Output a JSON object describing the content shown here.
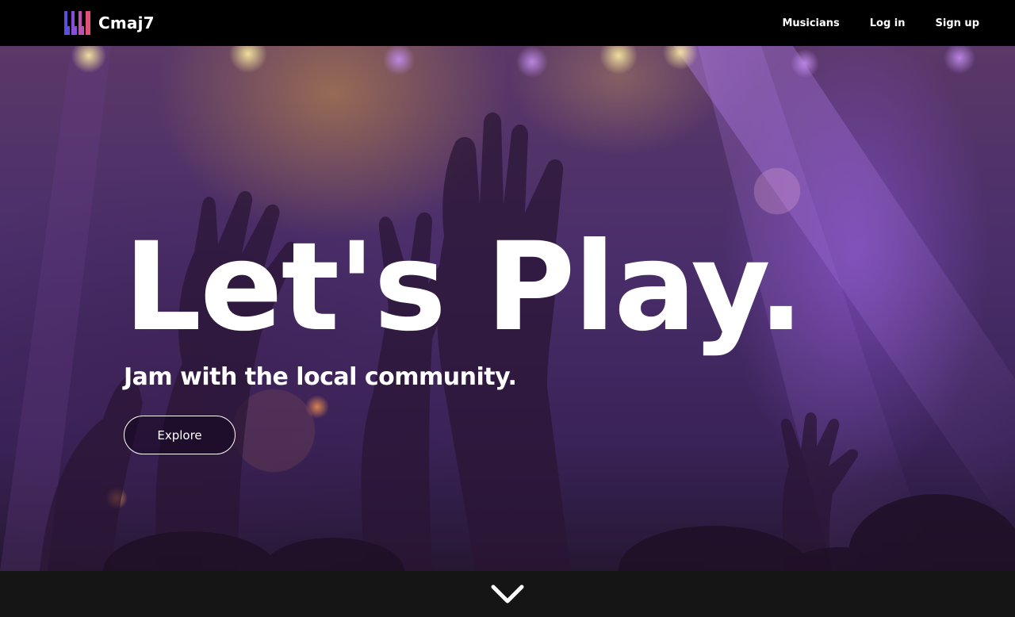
{
  "brand": {
    "name": "Cmaj7",
    "logo_icon": "piano-keys-icon",
    "logo_colors": [
      "#5b4fe0",
      "#8a4ed6",
      "#c24fb4",
      "#e2507a"
    ]
  },
  "nav": {
    "items": [
      {
        "label": "Musicians"
      },
      {
        "label": "Log in"
      },
      {
        "label": "Sign up"
      }
    ]
  },
  "hero": {
    "headline": "Let's Play.",
    "subheadline": "Jam with the local community.",
    "cta_label": "Explore",
    "background_image": "concert-crowd-hands-photo"
  },
  "footer": {
    "scroll_icon": "chevron-down-icon"
  },
  "colors": {
    "navbar_bg": "#000000",
    "bottom_bar_bg": "#151515",
    "text": "#ffffff",
    "hero_tint": "#4a2e6a"
  }
}
